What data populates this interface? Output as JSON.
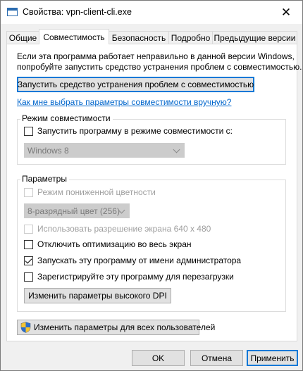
{
  "window": {
    "title": "Свойства: vpn-client-cli.exe"
  },
  "tabs": [
    {
      "label": "Общие"
    },
    {
      "label": "Совместимость"
    },
    {
      "label": "Безопасность"
    },
    {
      "label": "Подробно"
    },
    {
      "label": "Предыдущие версии"
    }
  ],
  "intro": {
    "line1": "Если эта программа работает неправильно в данной версии Windows,",
    "line2": "попробуйте запустить средство устранения проблем с совместимостью.",
    "troubleshoot_button": "Запустить средство устранения проблем с совместимостью",
    "manual_link": "Как мне выбрать параметры совместимости вручную?"
  },
  "compat_mode": {
    "group_label": "Режим совместимости",
    "checkbox_label": "Запустить программу в режиме совместимости с:",
    "checked": false,
    "os_select_value": "Windows 8"
  },
  "settings": {
    "group_label": "Параметры",
    "reduced_color": {
      "label": "Режим пониженной цветности",
      "checked": false,
      "enabled": false
    },
    "color_select_value": "8-разрядный цвет (256)",
    "resolution_640": {
      "label": "Использовать разрешение экрана 640 x 480",
      "checked": false,
      "enabled": false
    },
    "disable_fullscreen_opt": {
      "label": "Отключить оптимизацию во весь экран",
      "checked": false
    },
    "run_as_admin": {
      "label": "Запускать эту программу от имени администратора",
      "checked": true
    },
    "register_restart": {
      "label": "Зарегистрируйте эту программу для перезагрузки",
      "checked": false
    },
    "dpi_button": "Изменить параметры высокого DPI"
  },
  "all_users_button": "Изменить параметры для всех пользователей",
  "footer": {
    "ok": "OK",
    "cancel": "Отмена",
    "apply": "Применить"
  },
  "icons": {
    "window_icon": "app-window-icon",
    "close": "close-icon",
    "shield": "uac-shield-icon"
  },
  "colors": {
    "link": "#0066cc",
    "focus_border": "#0078d7",
    "disabled_text": "#9f9f9f"
  }
}
